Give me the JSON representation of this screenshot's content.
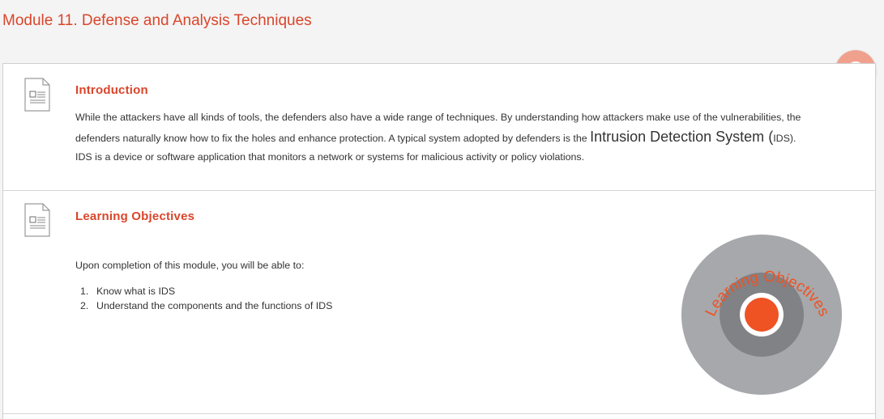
{
  "module": {
    "title": "Module 11. Defense and Analysis Techniques"
  },
  "help": {
    "glyph": "?"
  },
  "introduction": {
    "heading": "Introduction",
    "text_part1": "While the attackers have all kinds of tools, the defenders also have a wide range of techniques. By understanding how attackers  make use of the vulnerabilities, the defenders naturally know how to fix the holes and enhance protection. A typical system adopted by defenders is the ",
    "text_big": "Intrusion Detection System",
    "text_part2_open": " (",
    "text_abbrev": "IDS",
    "text_part3": "). IDS is a device or software application that monitors a network or systems for malicious activity or policy violations."
  },
  "learning_objectives": {
    "heading": "Learning Objectives",
    "lead": "Upon completion of this module, you will be able to:",
    "items": [
      {
        "num": "1.",
        "text": "Know what is IDS"
      },
      {
        "num": "2.",
        "text": "Understand the components and the functions of IDS"
      }
    ],
    "graphic_label": "Learning Objectives"
  },
  "colors": {
    "accent": "#d9462b",
    "target_outer": "#a7a8ab",
    "target_middle": "#818285",
    "target_center": "#ef5223",
    "help_button": "#f0a18d"
  },
  "icons": {
    "intro_icon": "document-icon",
    "objectives_icon": "document-icon",
    "help_icon": "help-icon",
    "graphic": "target-icon"
  }
}
